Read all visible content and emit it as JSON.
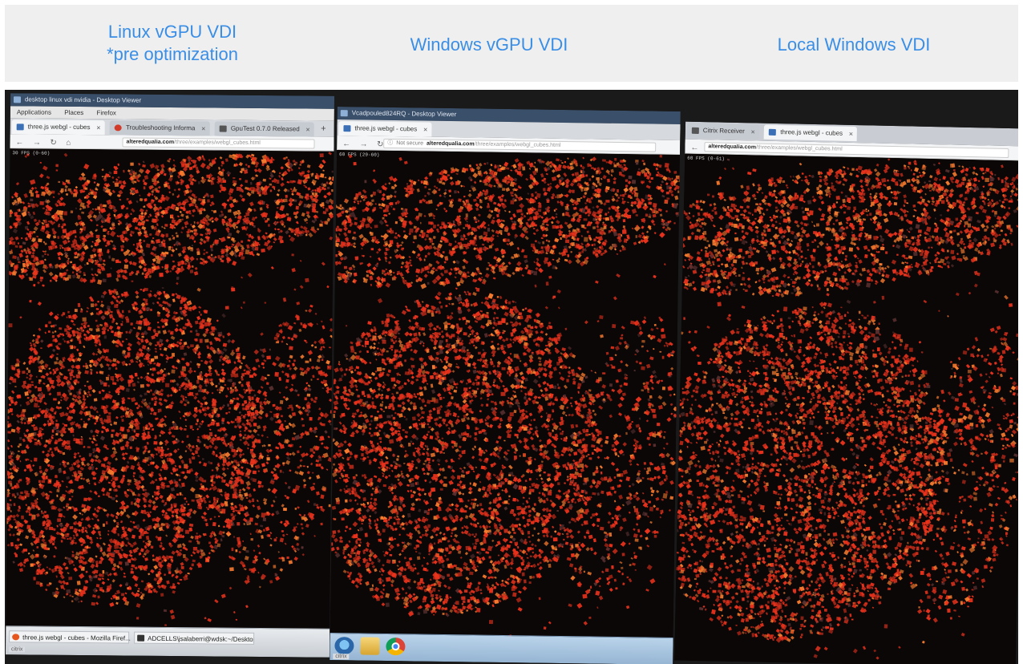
{
  "header": {
    "linux_label_line1": "Linux vGPU VDI",
    "linux_label_line2": "*pre optimization",
    "windows_label": "Windows vGPU VDI",
    "local_label": "Local Windows VDI"
  },
  "monitor_linux": {
    "titlebar": "desktop linux vdi nvidia - Desktop Viewer",
    "menu": [
      "Applications",
      "Places",
      "Firefox"
    ],
    "tabs": [
      {
        "label": "three.js webgl - cubes",
        "active": true,
        "favicon": "threejs-favicon"
      },
      {
        "label": "Troubleshooting Informa",
        "active": false,
        "favicon": "firefox-favicon"
      },
      {
        "label": "GpuTest 0.7.0 Released",
        "active": false,
        "favicon": "gputest-favicon"
      }
    ],
    "url_domain": "alteredqualia.com",
    "url_path": "/three/examples/webgl_cubes.html",
    "fps": "30 FPS (0-60)",
    "taskbar_items": [
      "three.js webgl - cubes - Mozilla Firef...",
      "ADCELLS\\jsalaberri@wdsk:~/Desktop..."
    ],
    "citrix": "citrix"
  },
  "monitor_windows": {
    "titlebar": "Vcadpouled824RQ - Desktop Viewer",
    "tabs": [
      {
        "label": "three.js webgl - cubes",
        "active": true
      }
    ],
    "not_secure": "Not secure",
    "url_domain": "alteredqualia.com",
    "url_path": "/three/examples/webgl_cubes.html",
    "fps": "60 FPS (29-60)",
    "citrix": "citrix"
  },
  "monitor_local": {
    "tabs": [
      {
        "label": "Citrix Receiver",
        "active": false
      },
      {
        "label": "three.js webgl - cubes",
        "active": true
      }
    ],
    "url_domain": "alteredqualia.com",
    "url_path": "/three/examples/webgl_cubes.html",
    "fps": "60 FPS (0-61)"
  },
  "colors": {
    "header_text": "#3a8ee6",
    "header_bg": "#efefef",
    "cube_primary": "#e8321c",
    "cube_highlight": "#f57a2e",
    "scene_bg": "#0b0707"
  }
}
